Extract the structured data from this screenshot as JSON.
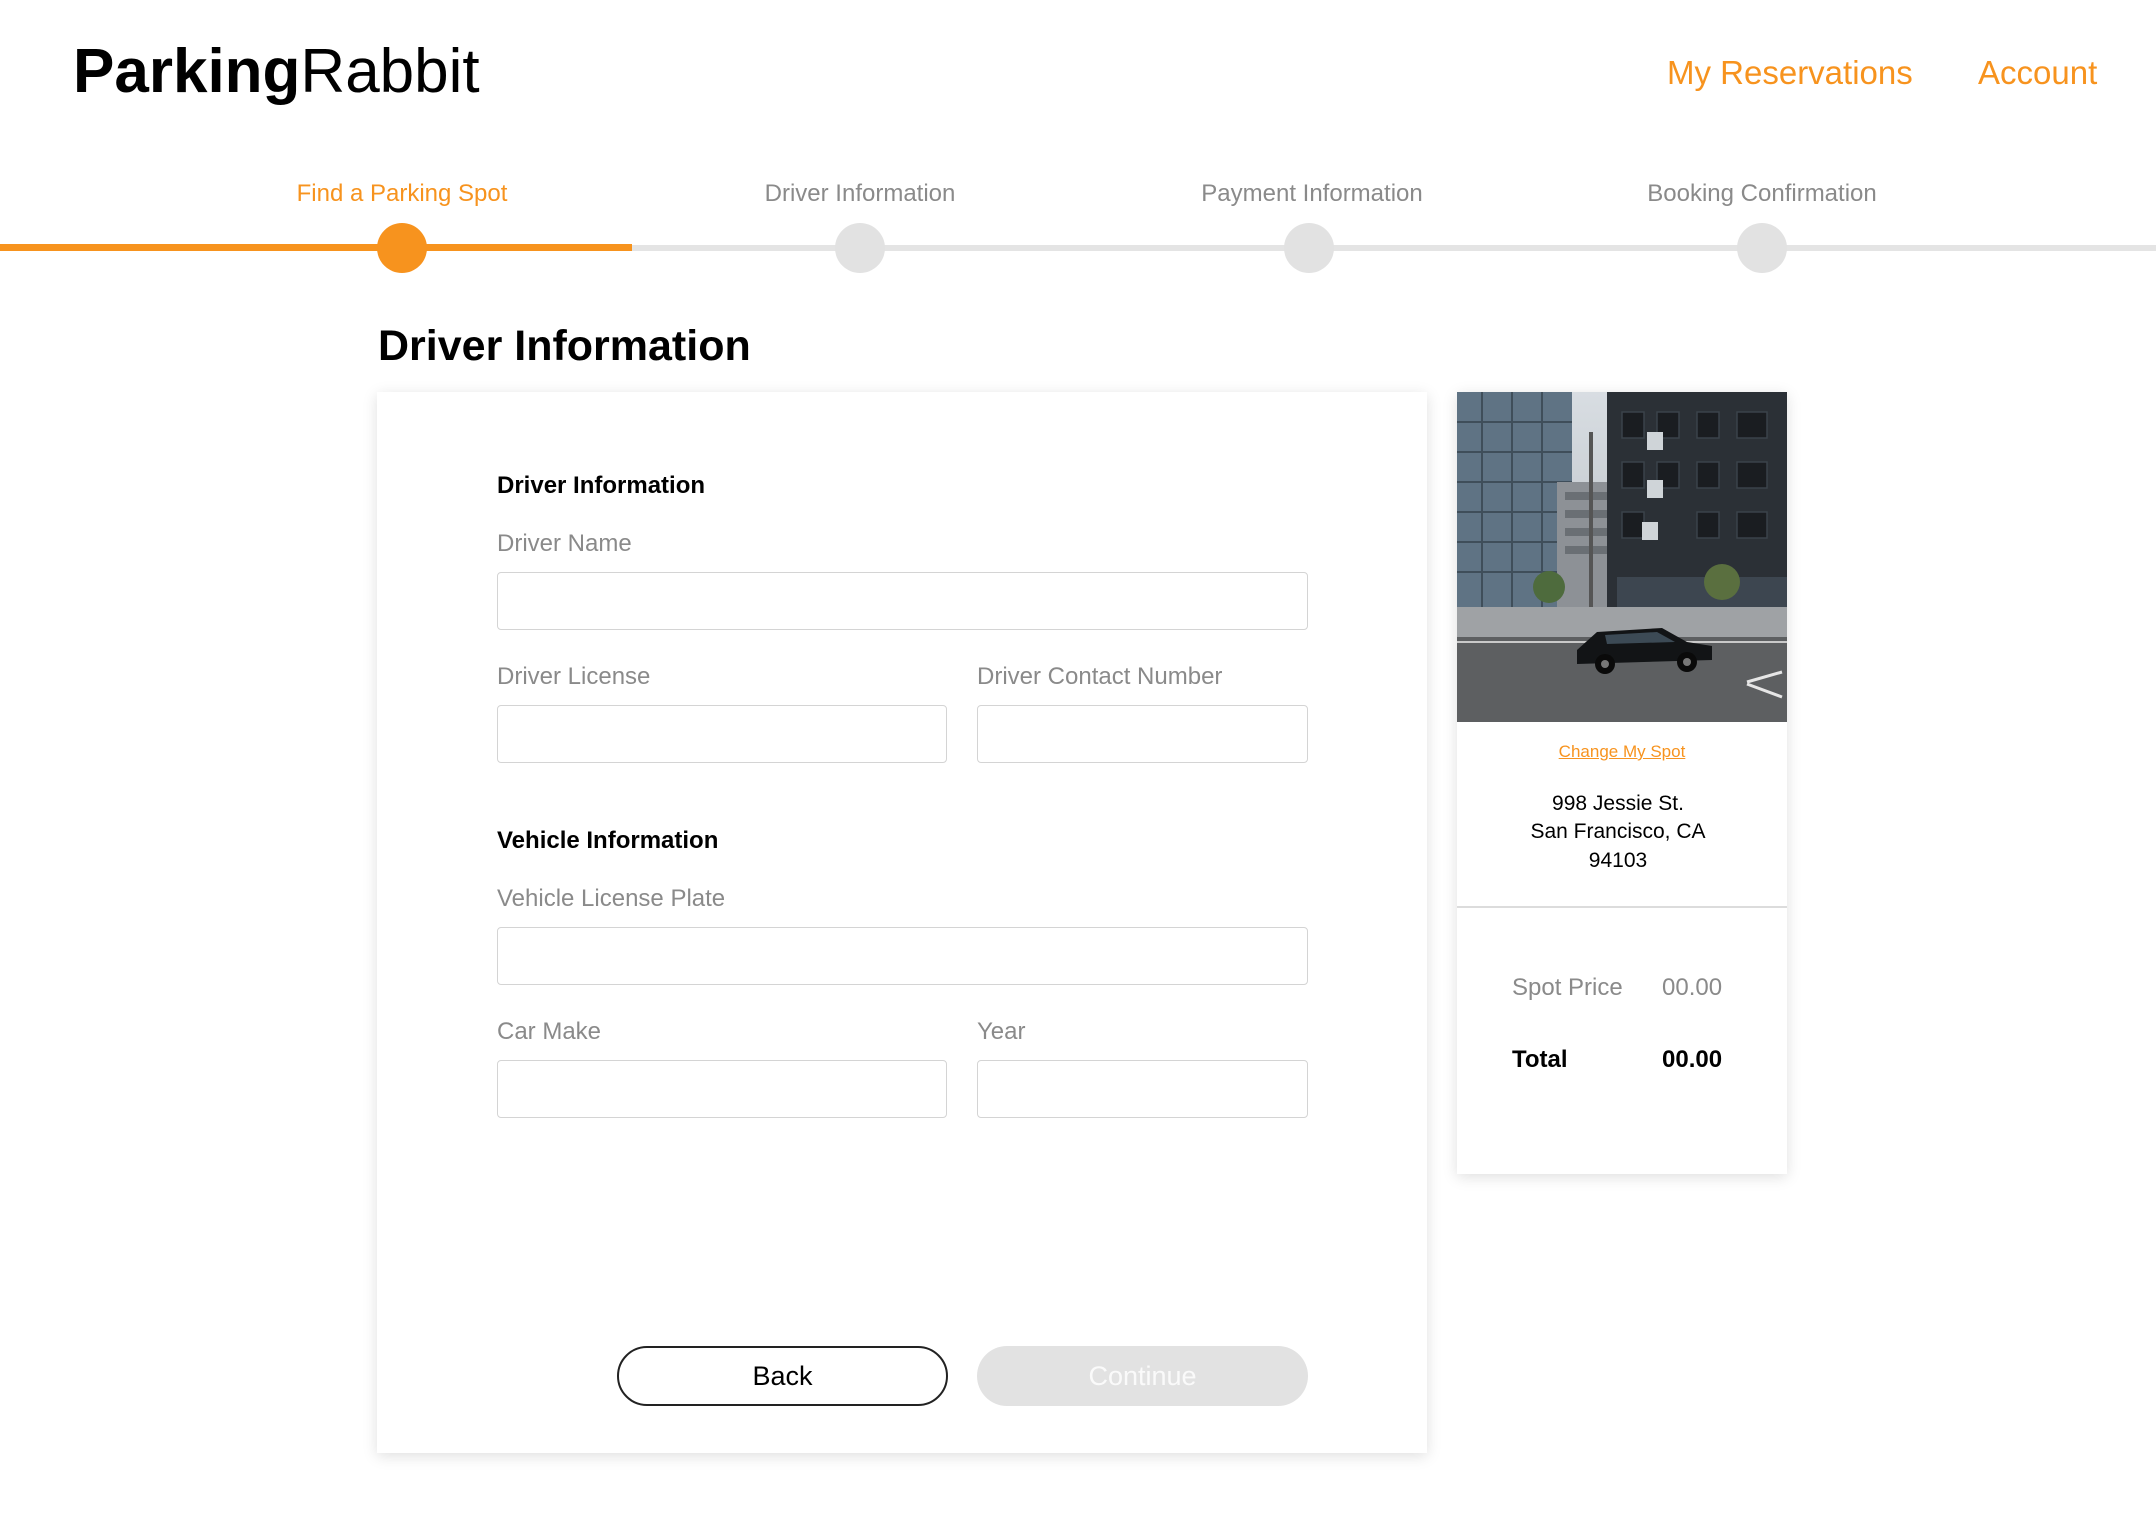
{
  "header": {
    "logo_bold": "Parking",
    "logo_regular": "Rabbit",
    "nav": {
      "reservations": "My Reservations",
      "account": "Account"
    }
  },
  "stepper": {
    "steps": [
      {
        "label": "Find a Parking Spot",
        "active": true
      },
      {
        "label": "Driver Information",
        "active": false
      },
      {
        "label": "Payment Information",
        "active": false
      },
      {
        "label": "Booking Confirmation",
        "active": false
      }
    ],
    "progress_fraction": 0.293
  },
  "page_title": "Driver Information",
  "form": {
    "driver_section": "Driver Information",
    "driver_name_label": "Driver Name",
    "driver_name_value": "",
    "driver_license_label": "Driver License",
    "driver_license_value": "",
    "driver_contact_label": "Driver Contact Number",
    "driver_contact_value": "",
    "vehicle_section": "Vehicle Information",
    "plate_label": "Vehicle License Plate",
    "plate_value": "",
    "make_label": "Car Make",
    "make_value": "",
    "year_label": "Year",
    "year_value": "",
    "back_label": "Back",
    "continue_label": "Continue"
  },
  "summary": {
    "change_link": "Change My Spot",
    "address_line1": "998 Jessie St.",
    "address_line2": "San Francisco, CA",
    "address_line3": "94103",
    "spot_price_label": "Spot Price",
    "spot_price_value": "00.00",
    "total_label": "Total",
    "total_value": "00.00"
  },
  "colors": {
    "accent": "#f7931e",
    "muted_text": "#8a8a8a",
    "inactive_step": "#e2e2e2",
    "input_border": "#d4d4d4"
  }
}
